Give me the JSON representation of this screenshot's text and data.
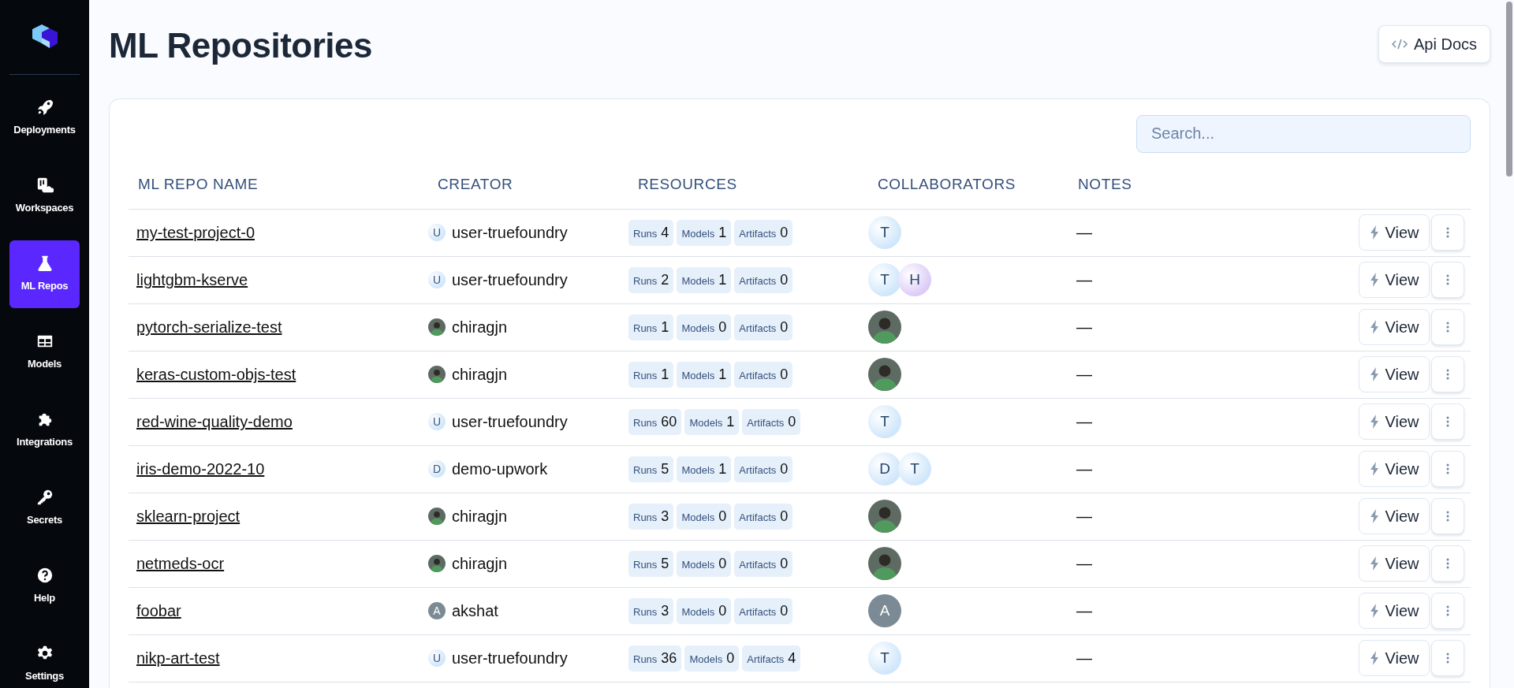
{
  "sidebar": {
    "items": [
      {
        "label": "Deployments",
        "selected": false
      },
      {
        "label": "Workspaces",
        "selected": false
      },
      {
        "label": "ML Repos",
        "selected": true
      },
      {
        "label": "Models",
        "selected": false
      },
      {
        "label": "Integrations",
        "selected": false
      },
      {
        "label": "Secrets",
        "selected": false
      },
      {
        "label": "Help",
        "selected": false
      },
      {
        "label": "Settings",
        "selected": false
      }
    ]
  },
  "page": {
    "title": "ML Repositories",
    "api_button": "Api Docs"
  },
  "search": {
    "placeholder": "Search..."
  },
  "table": {
    "columns": [
      "ML REPO NAME",
      "CREATOR",
      "RESOURCES",
      "COLLABORATORS",
      "NOTES"
    ],
    "rows": [
      {
        "name": "my-test-project-0",
        "creator": {
          "kind": "initial",
          "initial": "U",
          "color": "#cfe6fb",
          "name": "user-truefoundry"
        },
        "resources": [
          {
            "label": "Runs",
            "value": "4"
          },
          {
            "label": "Models",
            "value": "1"
          },
          {
            "label": "Artifacts",
            "value": "0"
          }
        ],
        "collaborators": [
          {
            "kind": "initial",
            "initial": "T",
            "color": "#cfe6fb"
          }
        ],
        "notes": "—",
        "view": "View"
      },
      {
        "name": "lightgbm-kserve",
        "creator": {
          "kind": "initial",
          "initial": "U",
          "color": "#cfe6fb",
          "name": "user-truefoundry"
        },
        "resources": [
          {
            "label": "Runs",
            "value": "2"
          },
          {
            "label": "Models",
            "value": "1"
          },
          {
            "label": "Artifacts",
            "value": "0"
          }
        ],
        "collaborators": [
          {
            "kind": "initial",
            "initial": "T",
            "color": "#cfe6fb"
          },
          {
            "kind": "initial",
            "initial": "H",
            "color": "#dccbf7"
          }
        ],
        "notes": "—",
        "view": "View"
      },
      {
        "name": "pytorch-serialize-test",
        "creator": {
          "kind": "photo",
          "name": "chiragjn"
        },
        "resources": [
          {
            "label": "Runs",
            "value": "1"
          },
          {
            "label": "Models",
            "value": "0"
          },
          {
            "label": "Artifacts",
            "value": "0"
          }
        ],
        "collaborators": [
          {
            "kind": "photo"
          }
        ],
        "notes": "—",
        "view": "View"
      },
      {
        "name": "keras-custom-objs-test",
        "creator": {
          "kind": "photo",
          "name": "chiragjn"
        },
        "resources": [
          {
            "label": "Runs",
            "value": "1"
          },
          {
            "label": "Models",
            "value": "1"
          },
          {
            "label": "Artifacts",
            "value": "0"
          }
        ],
        "collaborators": [
          {
            "kind": "photo"
          }
        ],
        "notes": "—",
        "view": "View"
      },
      {
        "name": "red-wine-quality-demo",
        "creator": {
          "kind": "initial",
          "initial": "U",
          "color": "#cfe6fb",
          "name": "user-truefoundry"
        },
        "resources": [
          {
            "label": "Runs",
            "value": "60"
          },
          {
            "label": "Models",
            "value": "1"
          },
          {
            "label": "Artifacts",
            "value": "0"
          }
        ],
        "collaborators": [
          {
            "kind": "initial",
            "initial": "T",
            "color": "#cfe6fb"
          }
        ],
        "notes": "—",
        "view": "View"
      },
      {
        "name": "iris-demo-2022-10",
        "creator": {
          "kind": "initial",
          "initial": "D",
          "color": "#cfe6fb",
          "name": "demo-upwork"
        },
        "resources": [
          {
            "label": "Runs",
            "value": "5"
          },
          {
            "label": "Models",
            "value": "1"
          },
          {
            "label": "Artifacts",
            "value": "0"
          }
        ],
        "collaborators": [
          {
            "kind": "initial",
            "initial": "D",
            "color": "#cfe6fb"
          },
          {
            "kind": "initial",
            "initial": "T",
            "color": "#cfe6fb"
          }
        ],
        "notes": "—",
        "view": "View"
      },
      {
        "name": "sklearn-project",
        "creator": {
          "kind": "photo",
          "name": "chiragjn"
        },
        "resources": [
          {
            "label": "Runs",
            "value": "3"
          },
          {
            "label": "Models",
            "value": "0"
          },
          {
            "label": "Artifacts",
            "value": "0"
          }
        ],
        "collaborators": [
          {
            "kind": "photo"
          }
        ],
        "notes": "—",
        "view": "View"
      },
      {
        "name": "netmeds-ocr",
        "creator": {
          "kind": "photo",
          "name": "chiragjn"
        },
        "resources": [
          {
            "label": "Runs",
            "value": "5"
          },
          {
            "label": "Models",
            "value": "0"
          },
          {
            "label": "Artifacts",
            "value": "0"
          }
        ],
        "collaborators": [
          {
            "kind": "photo"
          }
        ],
        "notes": "—",
        "view": "View"
      },
      {
        "name": "foobar",
        "creator": {
          "kind": "initial",
          "initial": "A",
          "color": "#7b8a95",
          "name": "akshat"
        },
        "resources": [
          {
            "label": "Runs",
            "value": "3"
          },
          {
            "label": "Models",
            "value": "0"
          },
          {
            "label": "Artifacts",
            "value": "0"
          }
        ],
        "collaborators": [
          {
            "kind": "initial",
            "initial": "A",
            "color": "#7b8a95"
          }
        ],
        "notes": "—",
        "view": "View"
      },
      {
        "name": "nikp-art-test",
        "creator": {
          "kind": "initial",
          "initial": "U",
          "color": "#cfe6fb",
          "name": "user-truefoundry"
        },
        "resources": [
          {
            "label": "Runs",
            "value": "36"
          },
          {
            "label": "Models",
            "value": "0"
          },
          {
            "label": "Artifacts",
            "value": "4"
          }
        ],
        "collaborators": [
          {
            "kind": "initial",
            "initial": "T",
            "color": "#cfe6fb"
          }
        ],
        "notes": "—",
        "view": "View"
      }
    ]
  }
}
